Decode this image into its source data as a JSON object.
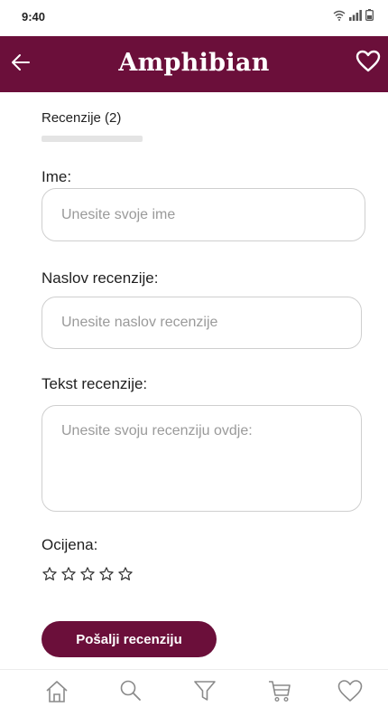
{
  "status_bar": {
    "time": "9:40",
    "icons": [
      "wifi-icon",
      "signal-icon",
      "battery-icon"
    ]
  },
  "app_bar": {
    "title": "Amphibian",
    "back_icon": "arrow-left-icon",
    "favorite_icon": "heart-icon"
  },
  "reviews": {
    "tab_label": "Recenzije (2)"
  },
  "form": {
    "name": {
      "label": "Ime:",
      "placeholder": "Unesite svoje ime",
      "value": ""
    },
    "title": {
      "label": "Naslov recenzije:",
      "placeholder": "Unesite naslov recenzije",
      "value": ""
    },
    "text": {
      "label": "Tekst recenzije:",
      "placeholder": "Unesite svoju recenziju ovdje:",
      "value": ""
    },
    "rating": {
      "label": "Ocijena:",
      "value": 0,
      "max": 5
    },
    "submit_label": "Pošalji recenziju"
  },
  "bottom_nav": {
    "items": [
      "home-icon",
      "search-icon",
      "filter-icon",
      "cart-icon",
      "heart-icon"
    ]
  },
  "colors": {
    "brand": "#6b0f3a",
    "background": "#ffffff",
    "input_border": "#cfcfcf",
    "placeholder": "#9a9a9a"
  }
}
